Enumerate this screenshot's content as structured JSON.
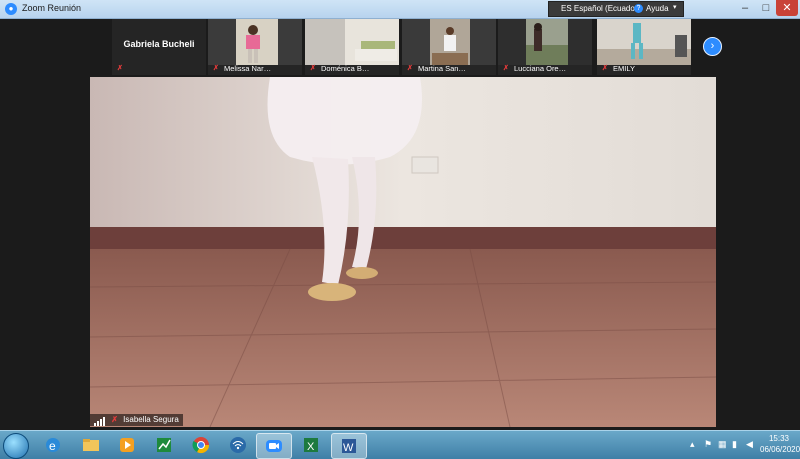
{
  "window": {
    "title": "Zoom Reunión",
    "language_label": "ES Español (Ecuador)",
    "help_label": "Ayuda",
    "controls": [
      "–",
      "□",
      "✕"
    ]
  },
  "participants": [
    {
      "name": "Gabriela Bucheli",
      "video": false,
      "muted": true
    },
    {
      "name": "Melissa Nar…",
      "video": true,
      "muted": true
    },
    {
      "name": "Doménica B…",
      "video": true,
      "muted": true
    },
    {
      "name": "Martina San…",
      "video": true,
      "muted": true
    },
    {
      "name": "Lucciana Ore…",
      "video": true,
      "muted": true
    },
    {
      "name": "EMILY",
      "video": true,
      "muted": true
    }
  ],
  "next_page_icon": "chevron-right-icon",
  "active_speaker": {
    "name": "Isabella Segura",
    "muted": true
  },
  "taskbar": {
    "apps": [
      "internet-explorer-icon",
      "file-explorer-icon",
      "media-player-icon",
      "chart-app-icon",
      "chrome-icon",
      "wifi-icon",
      "zoom-icon",
      "excel-icon",
      "word-icon"
    ],
    "clock_time": "15:33",
    "clock_date": "06/06/2020"
  },
  "colors": {
    "zoom_blue": "#2d8cff",
    "taskbar": "#4f8fb5",
    "close_red": "#c94237",
    "mute_red": "#e23b3b"
  }
}
